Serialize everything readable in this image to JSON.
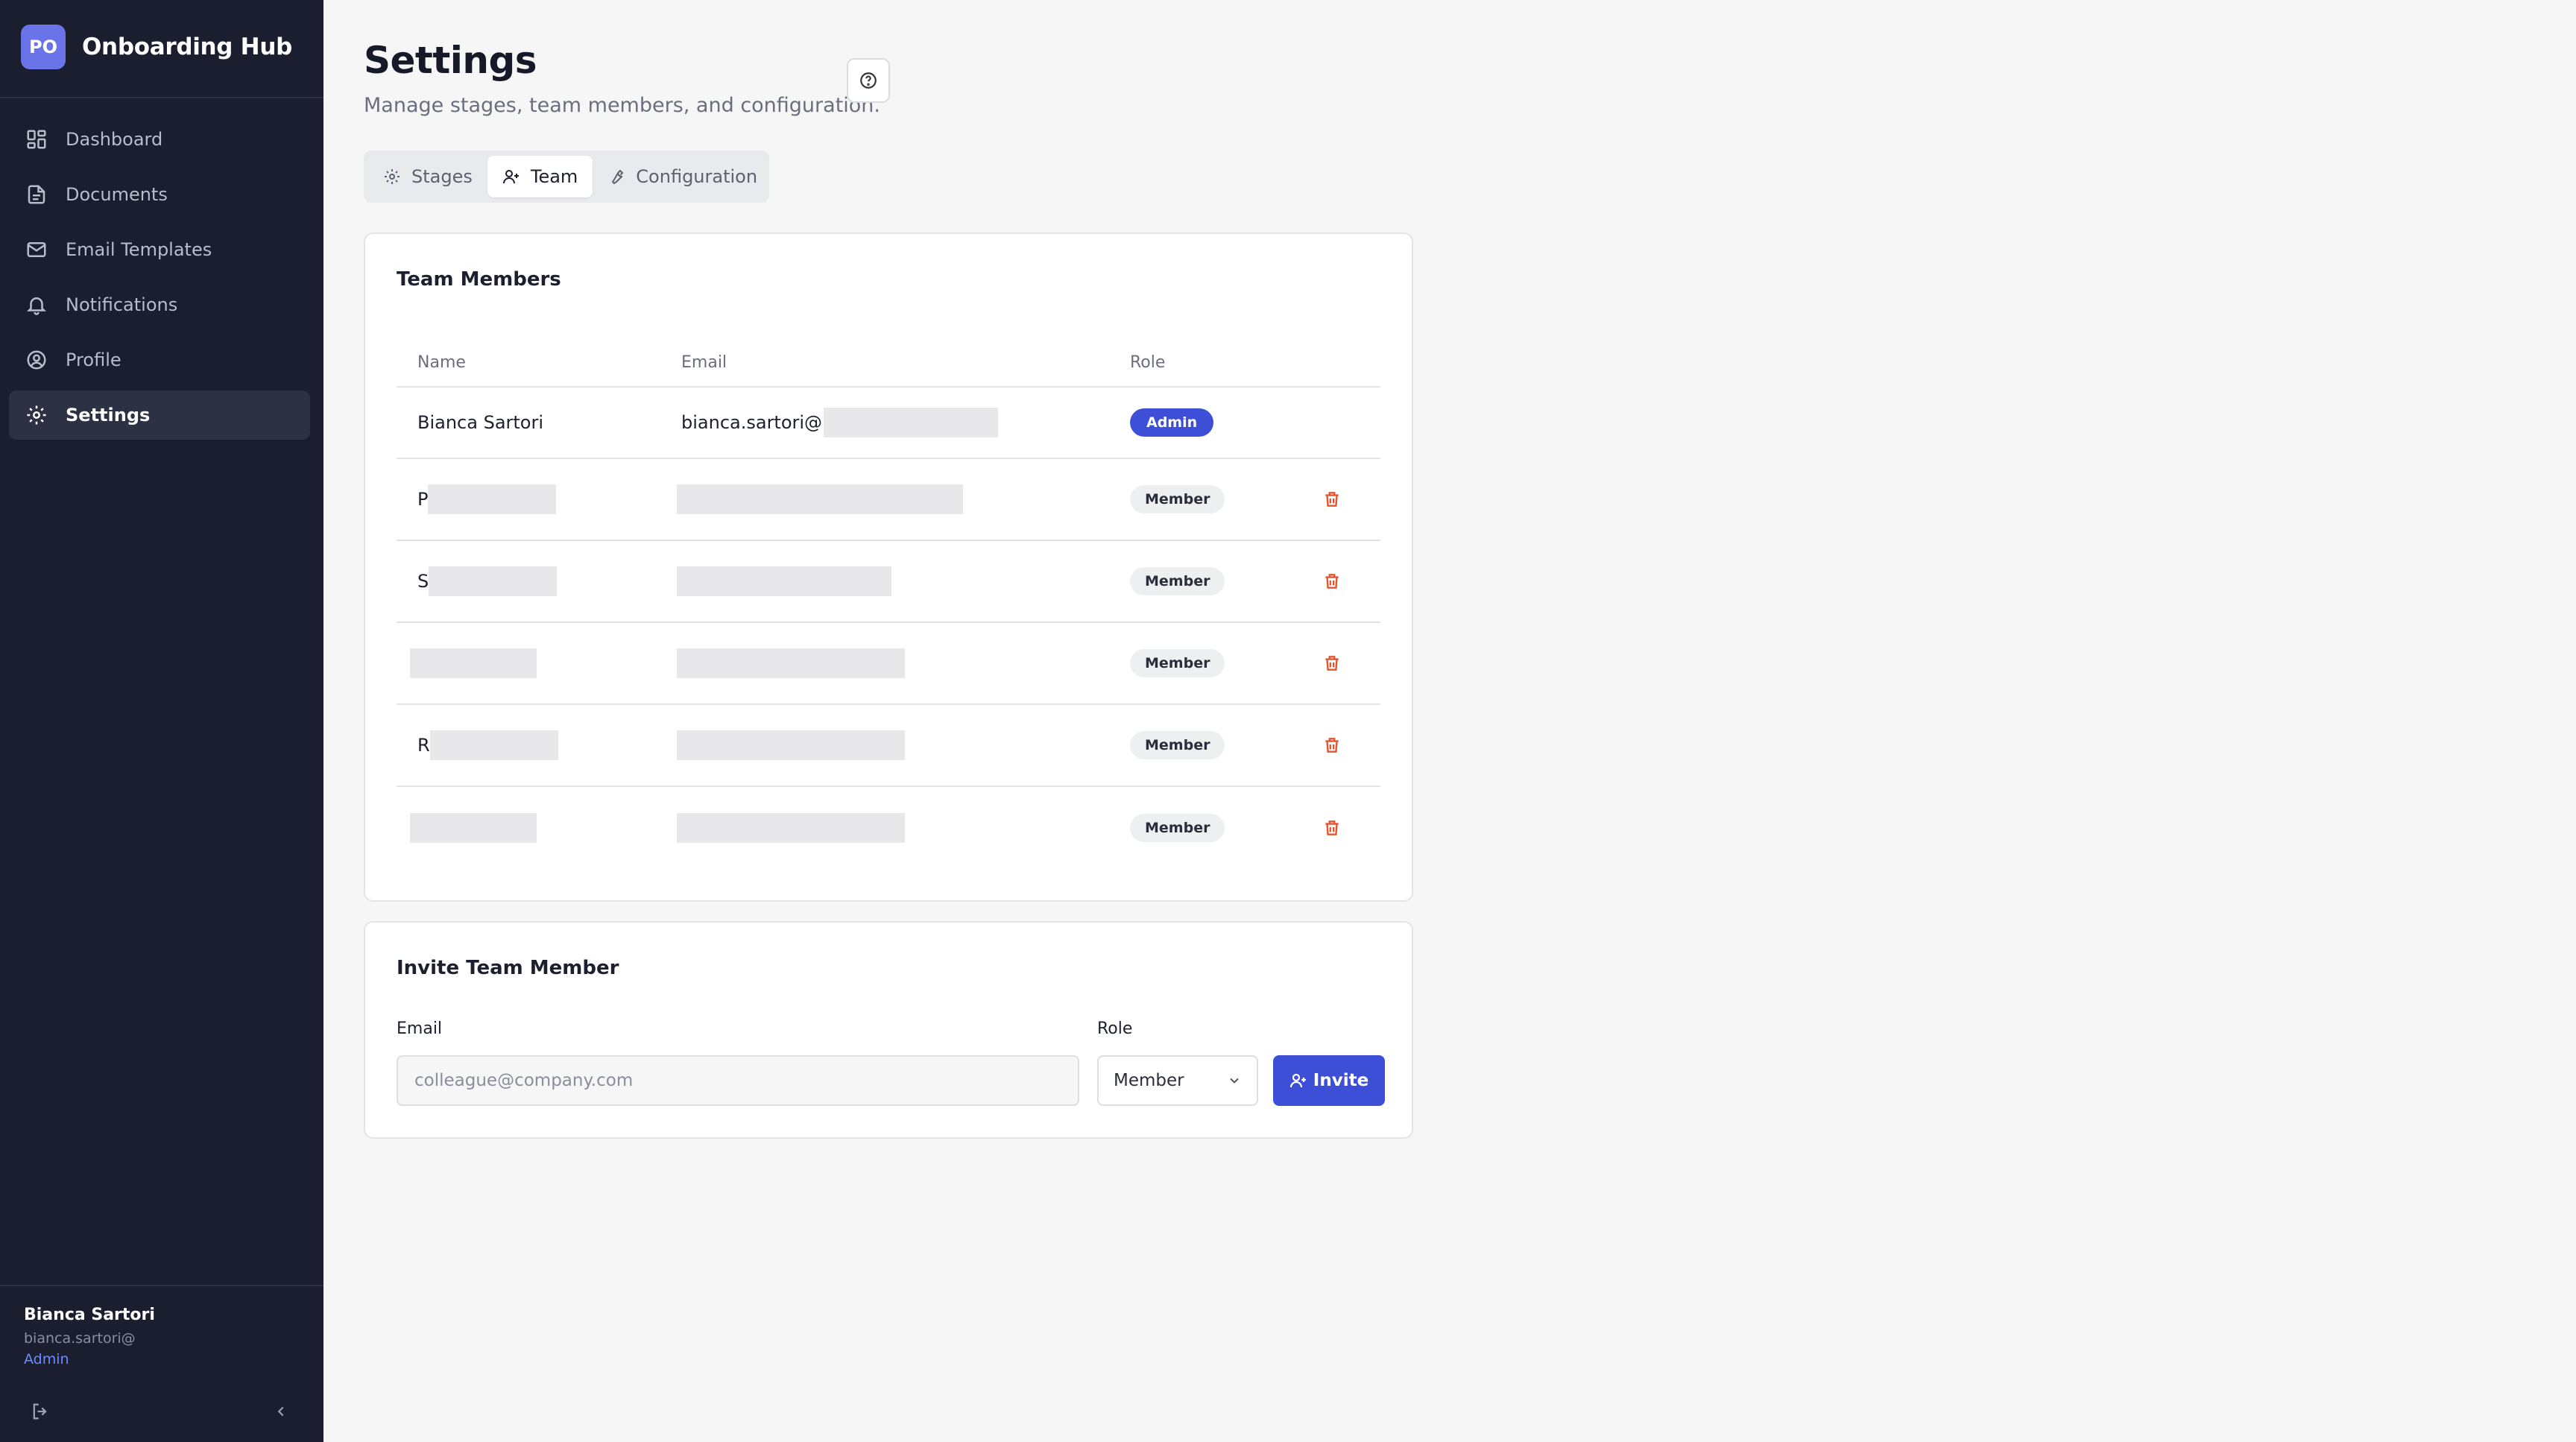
{
  "brand": {
    "logo_text": "PO",
    "name": "Onboarding Hub"
  },
  "nav": [
    {
      "label": "Dashboard",
      "icon": "dashboard-icon"
    },
    {
      "label": "Documents",
      "icon": "document-icon"
    },
    {
      "label": "Email Templates",
      "icon": "mail-icon"
    },
    {
      "label": "Notifications",
      "icon": "bell-icon"
    },
    {
      "label": "Profile",
      "icon": "user-circle-icon"
    },
    {
      "label": "Settings",
      "icon": "gear-icon",
      "active": true
    }
  ],
  "user": {
    "name": "Bianca Sartori",
    "email": "bianca.sartori@",
    "role": "Admin"
  },
  "page": {
    "title": "Settings",
    "subtitle": "Manage stages, team members, and configuration."
  },
  "tabs": [
    {
      "label": "Stages",
      "icon": "gear-icon"
    },
    {
      "label": "Team",
      "icon": "user-plus-icon",
      "active": true
    },
    {
      "label": "Configuration",
      "icon": "wrench-icon"
    }
  ],
  "team": {
    "title": "Team Members",
    "columns": {
      "name": "Name",
      "email": "Email",
      "role": "Role"
    },
    "rows": [
      {
        "name": "Bianca Sartori",
        "email": "bianca.sartori@",
        "role": "Admin"
      },
      {
        "name": "P",
        "email": "",
        "role": "Member"
      },
      {
        "name": "S",
        "email": "",
        "role": "Member"
      },
      {
        "name": "",
        "email": "",
        "role": "Member"
      },
      {
        "name": "R",
        "email": "",
        "role": "Member"
      },
      {
        "name": "",
        "email": "",
        "role": "Member"
      }
    ]
  },
  "invite": {
    "title": "Invite Team Member",
    "email_label": "Email",
    "email_placeholder": "colleague@company.com",
    "role_label": "Role",
    "role_value": "Member",
    "button_label": "Invite"
  },
  "colors": {
    "sidebar": "#1a1e2e",
    "accent": "#3d4fd6",
    "danger": "#e0562f"
  }
}
